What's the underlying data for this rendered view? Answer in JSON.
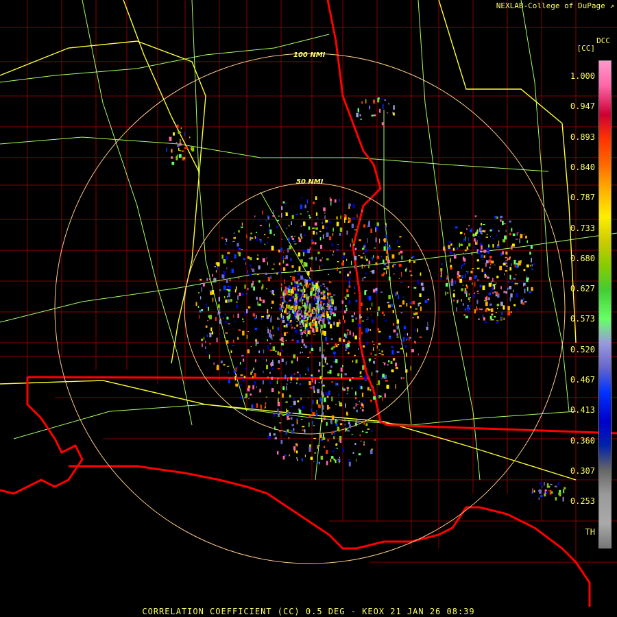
{
  "header": {
    "credit": "NEXLAB-College of DuPage"
  },
  "range_rings": {
    "inner_label": "50 NMI",
    "outer_label": "100 NMI"
  },
  "legend": {
    "title": "DCC",
    "units": "[CC]",
    "ticks": [
      "1.000",
      "0.947",
      "0.893",
      "0.840",
      "0.787",
      "0.733",
      "0.680",
      "0.627",
      "0.573",
      "0.520",
      "0.467",
      "0.413",
      "0.360",
      "0.307",
      "0.253",
      "TH"
    ],
    "color_stops": [
      "#ff99cc",
      "#ff66aa",
      "#cc0033",
      "#ff3300",
      "#ff6600",
      "#ffaa00",
      "#ffee00",
      "#cccc00",
      "#88cc00",
      "#44cc33",
      "#66ff66",
      "#9999dd",
      "#6666cc",
      "#0033ff",
      "#0000cc",
      "#0022aa",
      "#666666",
      "#999999",
      "#aaaaaa",
      "#777777"
    ]
  },
  "footer": {
    "caption": "CORRELATION COEFFICIENT (CC) 0.5 DEG - KEOX 21 JAN 26 08:39"
  },
  "colors": {
    "background": "#000000",
    "county_lines": "#880000",
    "state_lines": "#ff0000",
    "highways": "#aaff66",
    "interstates": "#ffff33",
    "rings": "#ffcc88",
    "text": "#ffff66"
  }
}
